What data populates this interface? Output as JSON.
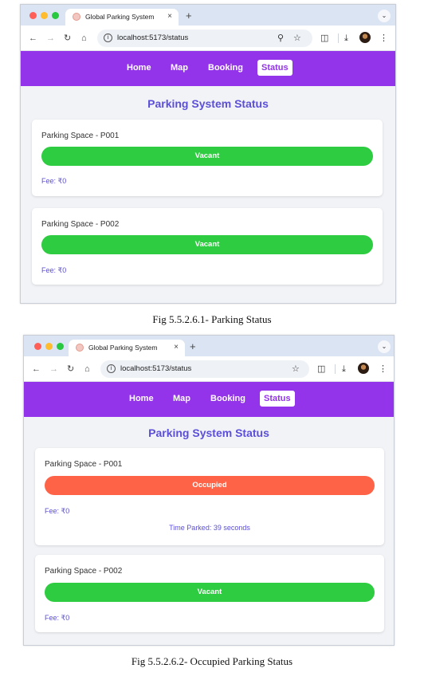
{
  "browser": {
    "tab_title": "Global Parking System",
    "tab_close": "×",
    "new_tab": "+",
    "tab_menu_icon": "chevron-down-icon",
    "url": "localhost:5173/status"
  },
  "colors": {
    "nav_purple": "#9333ea",
    "title_indigo": "#5b4fd9",
    "vacant_green": "#2ecc40",
    "occupied_red": "#ff6347",
    "page_bg": "#f2f3f7"
  },
  "app": {
    "nav": [
      "Home",
      "Map",
      "Booking",
      "Status"
    ],
    "active_nav": "Status",
    "page_title": "Parking System Status"
  },
  "figures": [
    {
      "cards": [
        {
          "space": "Parking Space - P001",
          "status": "Vacant",
          "fee": "Fee: ₹0"
        },
        {
          "space": "Parking Space - P002",
          "status": "Vacant",
          "fee": "Fee: ₹0"
        }
      ],
      "caption": "Fig 5.5.2.6.1- Parking Status"
    },
    {
      "cards": [
        {
          "space": "Parking Space - P001",
          "status": "Occupied",
          "fee": "Fee: ₹0",
          "time_parked": "Time Parked: 39 seconds"
        },
        {
          "space": "Parking Space - P002",
          "status": "Vacant",
          "fee": "Fee: ₹0"
        }
      ],
      "caption": "Fig 5.5.2.6.2- Occupied Parking Status"
    }
  ]
}
